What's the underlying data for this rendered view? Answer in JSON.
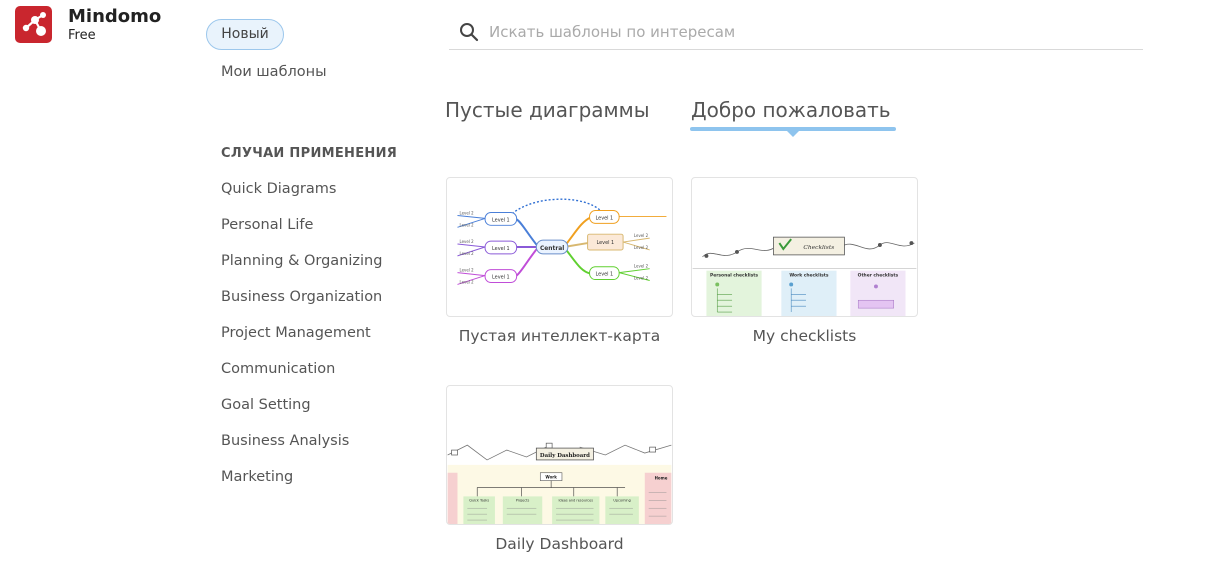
{
  "brand": {
    "name": "Mindomo",
    "plan": "Free"
  },
  "sidebar": {
    "new_button": "Новый",
    "my_templates": "Мои шаблоны",
    "use_cases_title": "СЛУЧАИ ПРИМЕНЕНИЯ",
    "use_cases": [
      "Quick Diagrams",
      "Personal Life",
      "Planning & Organizing",
      "Business Organization",
      "Project Management",
      "Communication",
      "Goal Setting",
      "Business Analysis",
      "Marketing"
    ]
  },
  "search": {
    "placeholder": "Искать шаблоны по интересам",
    "value": ""
  },
  "tabs": [
    {
      "label": "Пустые диаграммы",
      "active": false
    },
    {
      "label": "Добро пожаловать",
      "active": true
    }
  ],
  "accent_color": "#8ec4ee",
  "templates": [
    {
      "label": "Пустая интеллект-карта",
      "thumb_text": {
        "central": "Central",
        "level": "Level 1",
        "sub": "Level 2"
      }
    },
    {
      "label": "My checklists",
      "thumb_text": {
        "title": "Checklists",
        "cols": [
          "Personal checklists",
          "Work checklists",
          "Other checklists"
        ]
      }
    },
    {
      "label": "Daily Dashboard",
      "thumb_text": {
        "title": "Daily Dashboard",
        "work": "Work",
        "home": "Home",
        "cols": [
          "Quick Tasks",
          "Projects",
          "Ideas and resources",
          "Upcoming"
        ]
      }
    }
  ]
}
